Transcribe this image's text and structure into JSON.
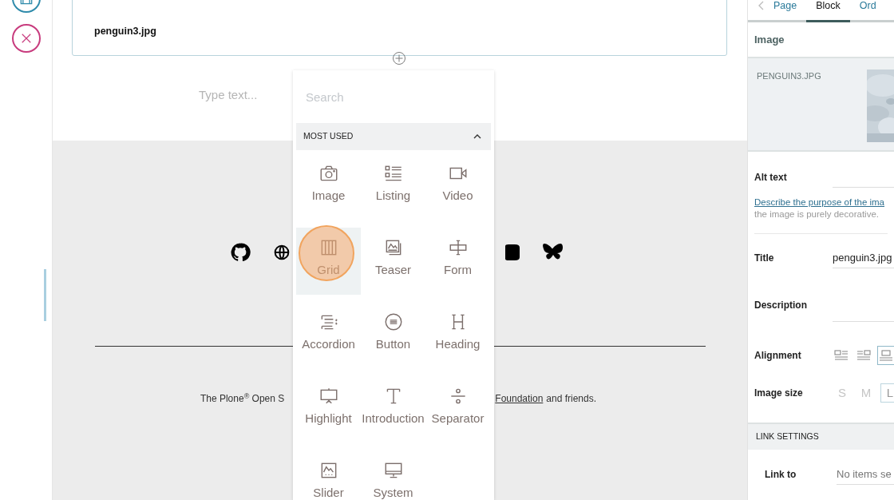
{
  "image_block": {
    "filename": "penguin3.jpg"
  },
  "text_block": {
    "placeholder": "Type text..."
  },
  "block_chooser": {
    "search": {
      "placeholder": "Search"
    },
    "section": {
      "title": "MOST USED",
      "expanded": true
    },
    "blocks": [
      {
        "label": "Image",
        "selected": false
      },
      {
        "label": "Listing",
        "kind": "listing",
        "selected": false
      },
      {
        "label": "Video",
        "kind": "video",
        "selected": false
      },
      {
        "label": "Grid",
        "kind": "grid",
        "selected": true
      },
      {
        "label": "Teaser",
        "kind": "teaser",
        "selected": false
      },
      {
        "label": "Form",
        "kind": "form",
        "selected": false
      },
      {
        "label": "Accordion",
        "kind": "accordion",
        "selected": false
      },
      {
        "label": "Button",
        "kind": "button",
        "selected": false
      },
      {
        "label": "Heading",
        "kind": "heading",
        "selected": false
      },
      {
        "label": "Highlight",
        "kind": "highlight",
        "selected": false
      },
      {
        "label": "Introduction",
        "kind": "introduction",
        "selected": false
      },
      {
        "label": "Separator",
        "kind": "separator",
        "selected": false
      },
      {
        "label": "Slider",
        "kind": "slider",
        "selected": false
      },
      {
        "label": "System",
        "kind": "system",
        "selected": false
      }
    ]
  },
  "footer": {
    "social_links": [
      {
        "kind": "github"
      },
      {
        "kind": "globe"
      },
      {
        "kind": "video"
      },
      {
        "kind": "butterfly"
      }
    ],
    "text_before": "The Plone$^{®}$ Open S",
    "link": "Foundation",
    "text_after": "and friends."
  },
  "sidebar": {
    "tabs": [
      {
        "label": "Page",
        "selected": false
      },
      {
        "label": "Block",
        "selected": true
      },
      {
        "label": "Ord",
        "selected": false
      }
    ],
    "section_title": "Image",
    "preview": {
      "filename": "PENGUIN3.JPG"
    },
    "alt_text": {
      "label": "Alt text",
      "help_link": "Describe the purpose of the ima",
      "help_text": "the image is purely decorative."
    },
    "title": {
      "label": "Title",
      "value": "penguin3.jpg"
    },
    "description": {
      "label": "Description"
    },
    "alignment": {
      "label": "Alignment",
      "options": [
        {
          "kind": "left",
          "selected": false
        },
        {
          "kind": "right",
          "selected": false
        },
        {
          "kind": "center",
          "selected": true
        }
      ]
    },
    "image_size": {
      "label": "Image size",
      "options": [
        {
          "label": "S",
          "selected": false
        },
        {
          "label": "M",
          "selected": false
        },
        {
          "label": "L",
          "selected": true
        }
      ]
    },
    "link_settings": {
      "title": "LINK SETTINGS",
      "link_to": {
        "label": "Link to",
        "placeholder": "No items se"
      }
    }
  }
}
